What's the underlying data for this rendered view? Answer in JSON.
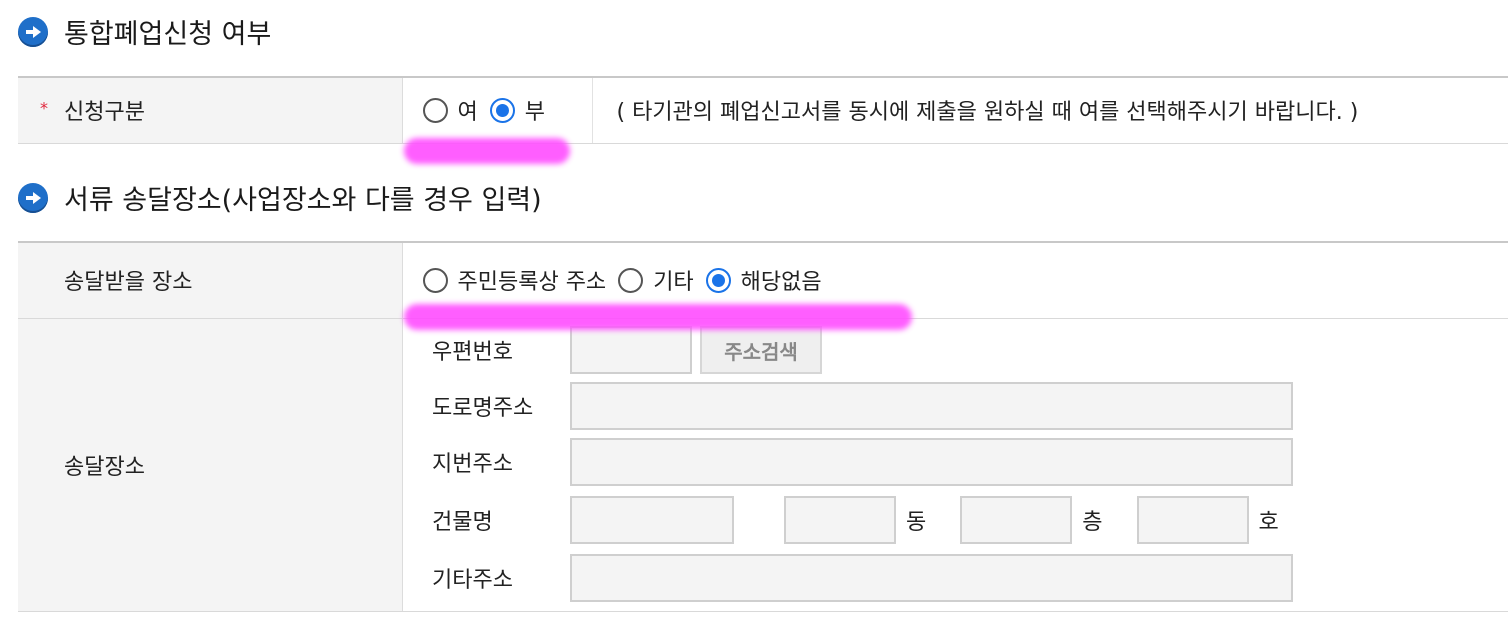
{
  "section1": {
    "title": "통합폐업신청 여부",
    "row": {
      "required_mark": "*",
      "label": "신청구분",
      "options": [
        {
          "label": "여",
          "checked": false
        },
        {
          "label": "부",
          "checked": true
        }
      ],
      "note": "( 타기관의 폐업신고서를 동시에 제출을 원하실 때 여를 선택해주시기 바랍니다. )"
    }
  },
  "section2": {
    "title": "서류 송달장소(사업장소와 다를 경우 입력)",
    "place_row": {
      "label": "송달받을 장소",
      "options": [
        {
          "label": "주민등록상 주소",
          "checked": false
        },
        {
          "label": "기타",
          "checked": false
        },
        {
          "label": "해당없음",
          "checked": true
        }
      ]
    },
    "address_row": {
      "label": "송달장소",
      "postcode_label": "우편번호",
      "postcode_value": "",
      "search_button": "주소검색",
      "road_label": "도로명주소",
      "road_value": "",
      "lot_label": "지번주소",
      "lot_value": "",
      "building_label": "건물명",
      "building_value": "",
      "dong_value": "",
      "dong_unit": "동",
      "floor_value": "",
      "floor_unit": "층",
      "ho_value": "",
      "ho_unit": "호",
      "etc_label": "기타주소",
      "etc_value": ""
    }
  },
  "colors": {
    "accent": "#1a73e8",
    "highlight": "#ff4dff",
    "required": "#e0243a"
  }
}
